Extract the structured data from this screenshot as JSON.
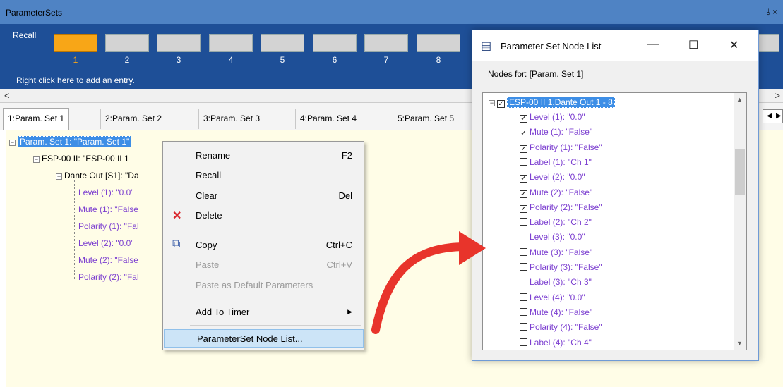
{
  "window": {
    "title": "ParameterSets",
    "pin_glyph": "⫰ ×"
  },
  "recall": {
    "label": "Recall",
    "slots": [
      "1",
      "2",
      "3",
      "4",
      "5",
      "6",
      "7",
      "8"
    ],
    "hint": "Right click here to add an entry."
  },
  "tabs": [
    "1:Param. Set 1",
    "2:Param. Set 2",
    "3:Param. Set 3",
    "4:Param. Set 4",
    "5:Param. Set 5"
  ],
  "tree": {
    "root": "Param. Set 1: \"Param. Set 1\"",
    "device": "ESP-00 II: \"ESP-00 II 1",
    "group": "Dante Out  [S1]: \"Da",
    "items": [
      "Level (1): \"0.0\"",
      "Mute (1): \"False",
      "Polarity (1): \"Fal",
      "Level (2): \"0.0\"",
      "Mute (2): \"False",
      "Polarity (2): \"Fal"
    ]
  },
  "context_menu": {
    "rename": "Rename",
    "rename_key": "F2",
    "recall": "Recall",
    "clear": "Clear",
    "clear_key": "Del",
    "delete": "Delete",
    "copy": "Copy",
    "copy_key": "Ctrl+C",
    "paste": "Paste",
    "paste_key": "Ctrl+V",
    "paste_default": "Paste as Default Parameters",
    "add_timer": "Add To Timer",
    "node_list": "ParameterSet Node List..."
  },
  "dialog": {
    "title": "Parameter Set Node List",
    "nodes_for": "Nodes for: [Param. Set 1]",
    "root": "ESP-00 II 1.Dante Out 1 - 8",
    "items": [
      {
        "label": "Level (1): \"0.0\"",
        "checked": true
      },
      {
        "label": "Mute (1): \"False\"",
        "checked": true
      },
      {
        "label": "Polarity (1): \"False\"",
        "checked": true
      },
      {
        "label": "Label (1): \"Ch 1\"",
        "checked": false
      },
      {
        "label": "Level (2): \"0.0\"",
        "checked": true
      },
      {
        "label": "Mute (2): \"False\"",
        "checked": true
      },
      {
        "label": "Polarity (2): \"False\"",
        "checked": true
      },
      {
        "label": "Label (2): \"Ch 2\"",
        "checked": false
      },
      {
        "label": "Level (3): \"0.0\"",
        "checked": false
      },
      {
        "label": "Mute (3): \"False\"",
        "checked": false
      },
      {
        "label": "Polarity (3): \"False\"",
        "checked": false
      },
      {
        "label": "Label (3): \"Ch 3\"",
        "checked": false
      },
      {
        "label": "Level (4): \"0.0\"",
        "checked": false
      },
      {
        "label": "Mute (4): \"False\"",
        "checked": false
      },
      {
        "label": "Polarity (4): \"False\"",
        "checked": false
      },
      {
        "label": "Label (4): \"Ch 4\"",
        "checked": false
      }
    ]
  },
  "colors": {
    "accent": "#f8a617",
    "recall_bg": "#1e4f97",
    "tree_text": "#7c3fd0",
    "pane_bg": "#fffde7",
    "arrow": "#e8342b"
  }
}
